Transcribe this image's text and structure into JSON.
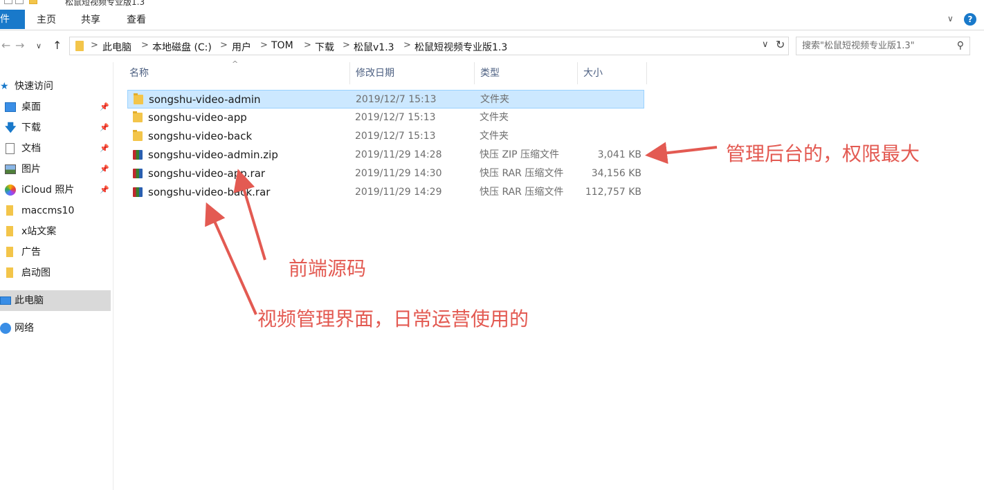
{
  "window": {
    "title": "松鼠短视频专业版1.3"
  },
  "ribbon": {
    "file_tab": "件",
    "tabs": [
      "主页",
      "共享",
      "查看"
    ],
    "expand_glyph": "∨",
    "help_glyph": "?"
  },
  "address": {
    "path": [
      "此电脑",
      "本地磁盘 (C:)",
      "用户",
      "TOM",
      "下载",
      "松鼠v1.3",
      "松鼠短视频专业版1.3"
    ],
    "separator": ">"
  },
  "search": {
    "placeholder": "搜索\"松鼠短视频专业版1.3\""
  },
  "sidebar": {
    "items": [
      {
        "label": "快速访问",
        "icon": "star-icon",
        "pinned": false
      },
      {
        "label": "桌面",
        "icon": "desktop-icon",
        "pinned": true
      },
      {
        "label": "下载",
        "icon": "download-icon",
        "pinned": true
      },
      {
        "label": "文档",
        "icon": "document-icon",
        "pinned": true
      },
      {
        "label": "图片",
        "icon": "picture-icon",
        "pinned": true
      },
      {
        "label": "iCloud 照片",
        "icon": "icloud-photos-icon",
        "pinned": true
      },
      {
        "label": "maccms10",
        "icon": "folder-icon",
        "pinned": false
      },
      {
        "label": "x站文案",
        "icon": "folder-icon",
        "pinned": false
      },
      {
        "label": "广告",
        "icon": "folder-icon",
        "pinned": false
      },
      {
        "label": "启动图",
        "icon": "folder-icon",
        "pinned": false
      },
      {
        "label": "此电脑",
        "icon": "this-pc-icon",
        "pinned": false,
        "selected": true
      },
      {
        "label": "网络",
        "icon": "network-icon",
        "pinned": false
      }
    ]
  },
  "columns": {
    "name": "名称",
    "date": "修改日期",
    "type": "类型",
    "size": "大小"
  },
  "files": [
    {
      "name": "songshu-video-admin",
      "date": "2019/12/7 15:13",
      "type": "文件夹",
      "size": "",
      "icon": "folder-icon",
      "selected": true
    },
    {
      "name": "songshu-video-app",
      "date": "2019/12/7 15:13",
      "type": "文件夹",
      "size": "",
      "icon": "folder-icon"
    },
    {
      "name": "songshu-video-back",
      "date": "2019/12/7 15:13",
      "type": "文件夹",
      "size": "",
      "icon": "folder-icon"
    },
    {
      "name": "songshu-video-admin.zip",
      "date": "2019/11/29 14:28",
      "type": "快压 ZIP 压缩文件",
      "size": "3,041 KB",
      "icon": "archive-icon"
    },
    {
      "name": "songshu-video-app.rar",
      "date": "2019/11/29 14:30",
      "type": "快压 RAR 压缩文件",
      "size": "34,156 KB",
      "icon": "archive-icon"
    },
    {
      "name": "songshu-video-back.rar",
      "date": "2019/11/29 14:29",
      "type": "快压 RAR 压缩文件",
      "size": "112,757 KB",
      "icon": "archive-icon"
    }
  ],
  "annotations": {
    "admin_note": "管理后台的，权限最大",
    "app_note": "前端源码",
    "back_note": "视频管理界面，日常运营使用的",
    "color": "#e35a52"
  }
}
